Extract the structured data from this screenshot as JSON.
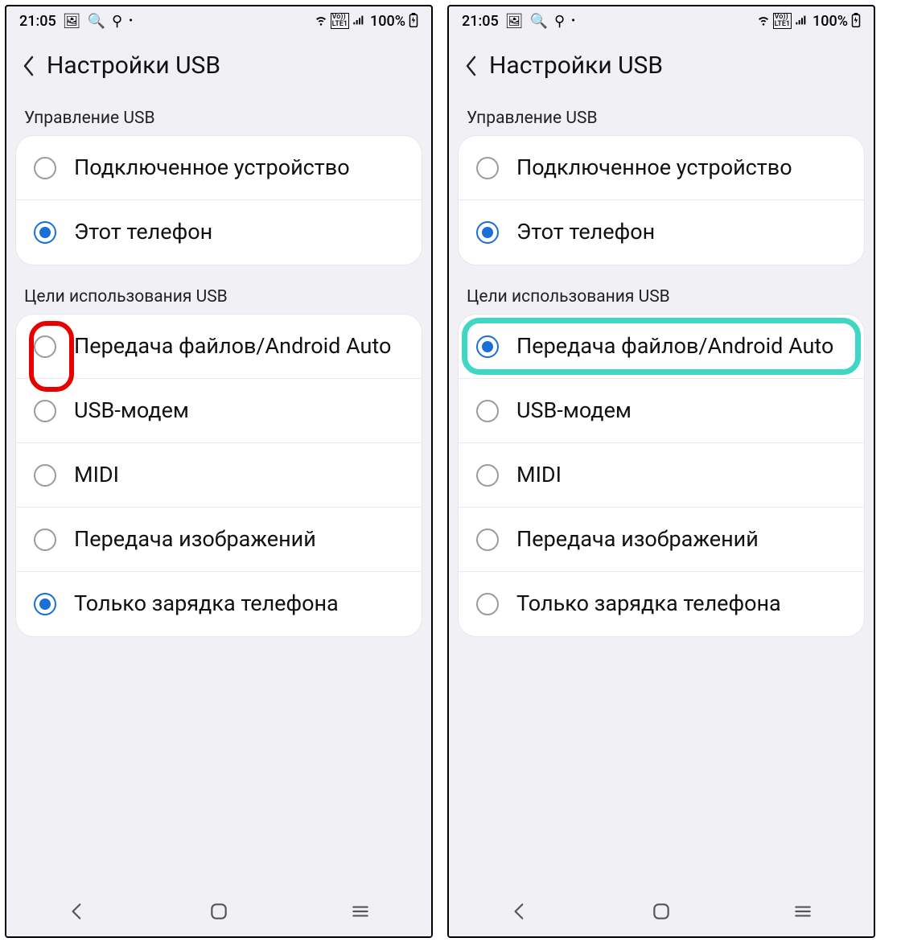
{
  "status": {
    "time": "21:05",
    "left_icons": [
      "image-icon",
      "search-icon",
      "usb-icon",
      "dot"
    ],
    "right_text": "100%",
    "right_icons": [
      "wifi-icon",
      "volte-icon",
      "signal-icon",
      "battery-charging-icon"
    ]
  },
  "appbar": {
    "title": "Настройки USB"
  },
  "section1": {
    "header": "Управление USB",
    "items": [
      {
        "label": "Подключенное устройство",
        "selected": false
      },
      {
        "label": "Этот телефон",
        "selected": true
      }
    ]
  },
  "section2": {
    "header": "Цели использования USB",
    "items": [
      {
        "label": "Передача файлов/Android Auto"
      },
      {
        "label": "USB-модем"
      },
      {
        "label": "MIDI"
      },
      {
        "label": "Передача изображений"
      },
      {
        "label": "Только зарядка телефона"
      }
    ]
  },
  "screens": [
    {
      "usb_goal_selected_index": 4,
      "highlight": {
        "type": "red",
        "row_index": 0
      }
    },
    {
      "usb_goal_selected_index": 0,
      "highlight": {
        "type": "teal",
        "row_index": 0
      }
    }
  ],
  "nav": {
    "buttons": [
      "back",
      "home",
      "recents"
    ]
  }
}
